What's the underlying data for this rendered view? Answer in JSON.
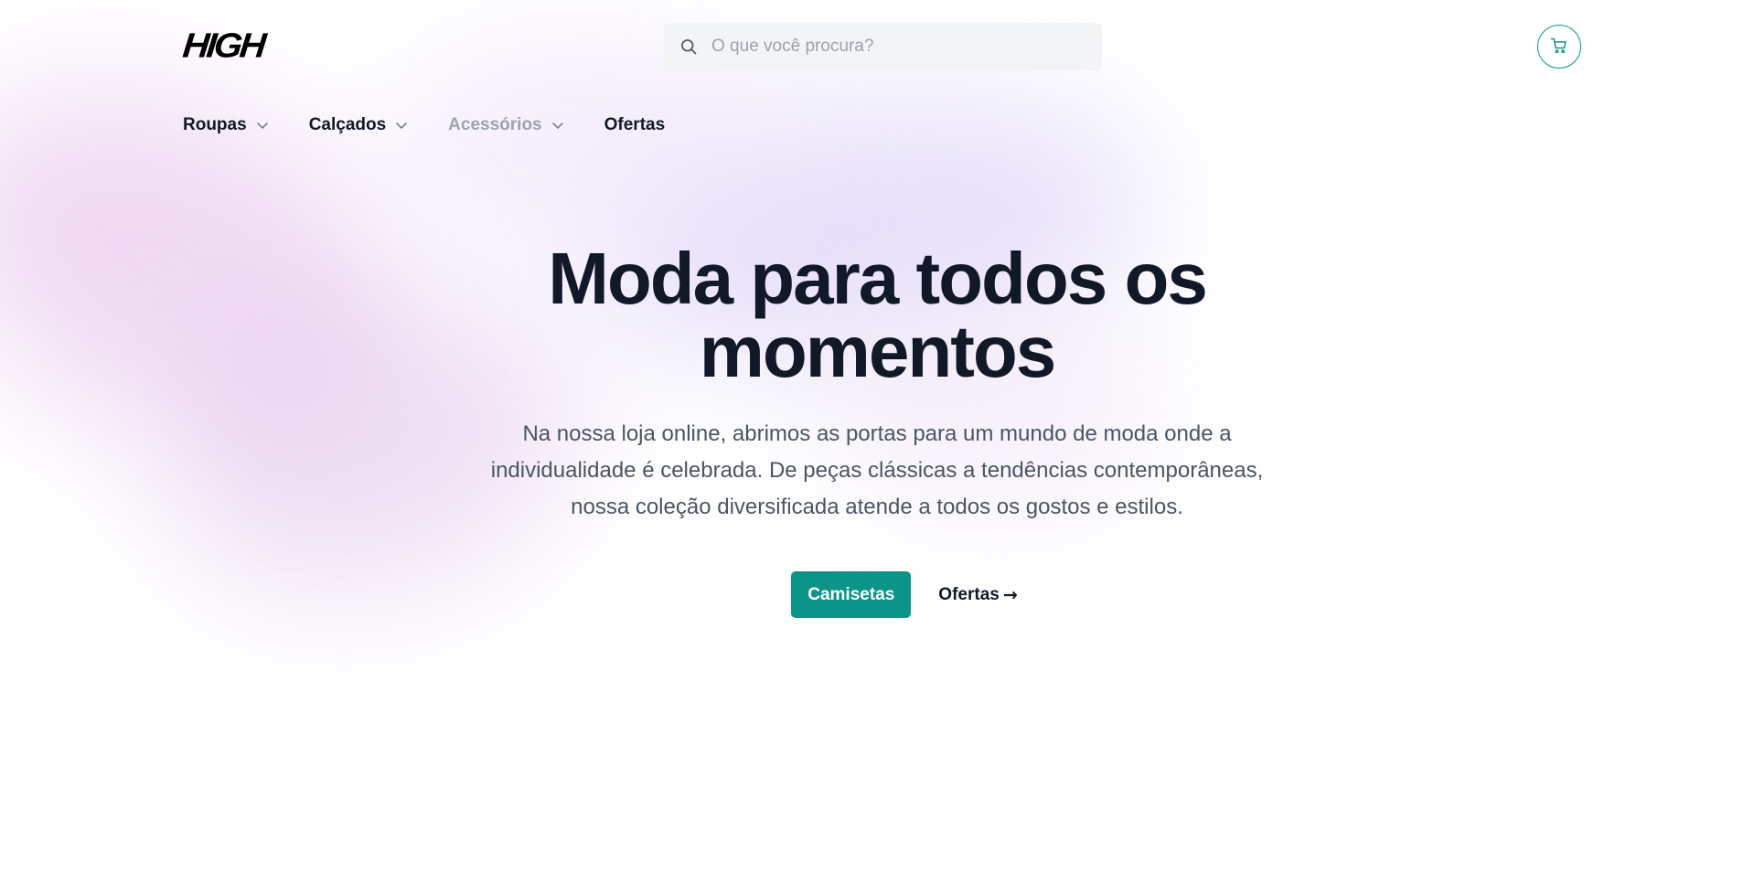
{
  "brand": {
    "logo_text": "HIGH"
  },
  "search": {
    "placeholder": "O que você procura?",
    "icon": "search-icon"
  },
  "cart": {
    "icon": "shopping-cart-icon",
    "accent": "#0d9488"
  },
  "nav": {
    "items": [
      {
        "label": "Roupas",
        "has_dropdown": true
      },
      {
        "label": "Calçados",
        "has_dropdown": true
      },
      {
        "label": "Acessórios",
        "has_dropdown": true
      },
      {
        "label": "Ofertas",
        "has_dropdown": false
      }
    ]
  },
  "hero": {
    "title_line1": "Moda para todos os",
    "title_line2": "momentos",
    "text_line1": "Na nossa loja online, abrimos as portas para um mundo de moda onde a",
    "text_line2": "individualidade é celebrada. De peças clássicas a tendências contemporâneas,",
    "text_line3": "nossa coleção diversificada atende a todos os gostos e estilos.",
    "primary_button": "Camisetas",
    "secondary_link": "Ofertas",
    "secondary_arrow": "→"
  },
  "colors": {
    "primary": "#0d9488",
    "text_dark": "#111827",
    "text_muted": "#4b5563",
    "nav_muted": "#9ca3af"
  }
}
